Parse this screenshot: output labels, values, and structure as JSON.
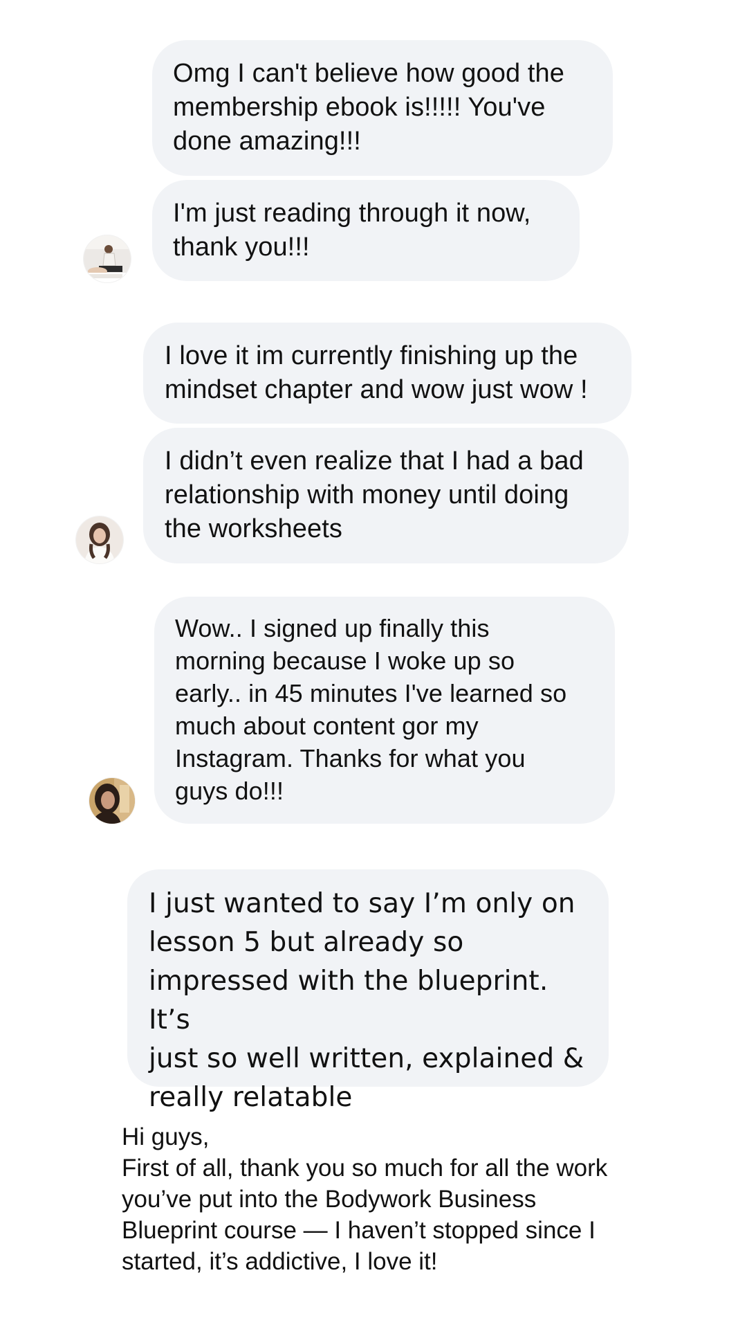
{
  "conversation_1": {
    "bubble_1": {
      "lines": [
        "Omg I can't believe how good the",
        "membership ebook is!!!!! You've",
        "done amazing!!!"
      ]
    },
    "bubble_2": {
      "lines": [
        "I'm just reading through it now,",
        "thank you!!!"
      ]
    },
    "avatar": "massage-photo-avatar"
  },
  "conversation_2": {
    "bubble_1": {
      "lines": [
        "I love it im currently finishing up the",
        "mindset chapter and wow just wow !"
      ]
    },
    "bubble_2": {
      "lines": [
        "I didn’t even realize that I had a bad",
        "relationship with money until doing",
        "the worksheets"
      ]
    },
    "avatar": "woman-portrait-avatar"
  },
  "conversation_3": {
    "bubble_1": {
      "lines": [
        "Wow.. I signed up finally this",
        "morning because I woke up so",
        "early.. in 45 minutes I've learned so",
        "much about content gor my",
        "Instagram. Thanks for what you",
        "guys do!!!"
      ]
    },
    "avatar": "woman-selfie-avatar"
  },
  "conversation_4": {
    "bubble_1": {
      "lines": [
        "I just wanted to say I’m only on",
        "lesson 5 but already so",
        "impressed with the blueprint. It’s",
        "just so well written, explained &",
        "really relatable"
      ]
    }
  },
  "email_text": {
    "lines": [
      "Hi guys,",
      "First of all, thank you so much for all the work",
      "you’ve put into the Bodywork Business",
      "Blueprint course — I haven’t stopped since I",
      "started, it’s addictive, I love it!"
    ]
  },
  "colors": {
    "bubble_bg": "#f1f3f6",
    "text": "#111111",
    "page_bg": "#ffffff"
  }
}
